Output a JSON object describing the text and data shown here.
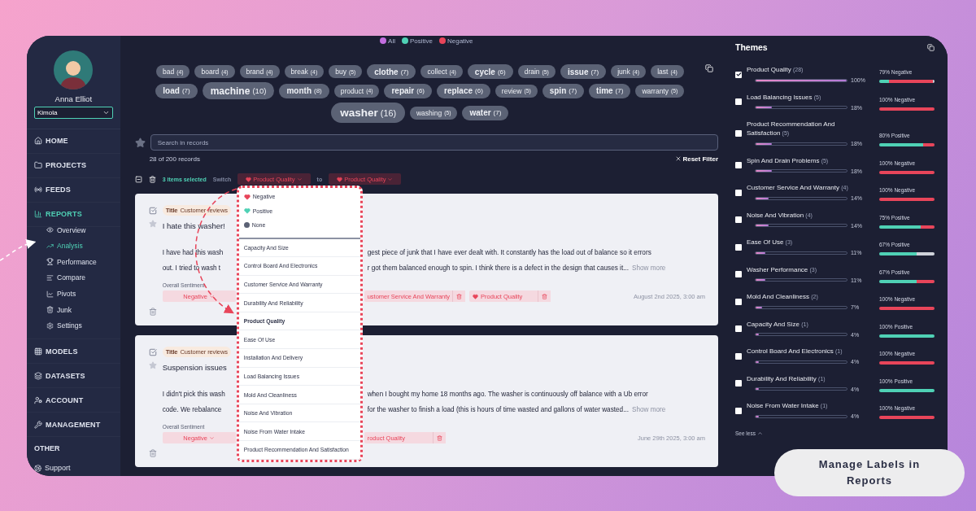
{
  "sidebar": {
    "user_name": "Anna Elliot",
    "workspace": "Kimola",
    "nav": [
      {
        "label": "HOME",
        "kind": "section",
        "selected": false
      },
      {
        "label": "PROJECTS",
        "kind": "section",
        "selected": false
      },
      {
        "label": "FEEDS",
        "kind": "section",
        "selected": false
      },
      {
        "label": "REPORTS",
        "kind": "section",
        "selected": true,
        "children": [
          {
            "label": "Overview",
            "selected": false
          },
          {
            "label": "Analysis",
            "selected": true
          },
          {
            "label": "Performance",
            "selected": false
          },
          {
            "label": "Compare",
            "selected": false
          },
          {
            "label": "Pivots",
            "selected": false
          },
          {
            "label": "Junk",
            "selected": false
          },
          {
            "label": "Settings",
            "selected": false
          }
        ]
      },
      {
        "label": "MODELS",
        "kind": "section",
        "selected": false
      },
      {
        "label": "DATASETS",
        "kind": "section",
        "selected": false
      },
      {
        "label": "ACCOUNT",
        "kind": "section",
        "selected": false
      },
      {
        "label": "MANAGEMENT",
        "kind": "section",
        "selected": false
      },
      {
        "label": "OTHER",
        "kind": "heading"
      },
      {
        "label": "Support",
        "kind": "link",
        "selected": false
      }
    ]
  },
  "legend": [
    {
      "label": "All",
      "color": "#c36ee0"
    },
    {
      "label": "Positive",
      "color": "#4fd1b5"
    },
    {
      "label": "Negative",
      "color": "#e8455a"
    }
  ],
  "tag_rows": [
    [
      {
        "word": "bad",
        "count": "(4)",
        "kind": "s"
      },
      {
        "word": "board",
        "count": "(4)",
        "kind": "s"
      },
      {
        "word": "brand",
        "count": "(4)",
        "kind": "s"
      },
      {
        "word": "break",
        "count": "(4)",
        "kind": "s"
      },
      {
        "word": "buy",
        "count": "(5)",
        "kind": "s"
      },
      {
        "word": "clothe",
        "count": "(7)",
        "kind": "m"
      },
      {
        "word": "collect",
        "count": "(4)",
        "kind": "s"
      },
      {
        "word": "cycle",
        "count": "(6)",
        "kind": "m"
      },
      {
        "word": "drain",
        "count": "(5)",
        "kind": "s"
      },
      {
        "word": "issue",
        "count": "(7)",
        "kind": "m"
      },
      {
        "word": "junk",
        "count": "(4)",
        "kind": "s"
      },
      {
        "word": "last",
        "count": "(4)",
        "kind": "s"
      }
    ],
    [
      {
        "word": "load",
        "count": "(7)",
        "kind": "m"
      },
      {
        "word": "machine",
        "count": "(10)",
        "kind": "l"
      },
      {
        "word": "month",
        "count": "(8)",
        "kind": "m"
      },
      {
        "word": "product",
        "count": "(4)",
        "kind": "s"
      },
      {
        "word": "repair",
        "count": "(6)",
        "kind": "m"
      },
      {
        "word": "replace",
        "count": "(6)",
        "kind": "m"
      },
      {
        "word": "review",
        "count": "(5)",
        "kind": "s"
      },
      {
        "word": "spin",
        "count": "(7)",
        "kind": "m"
      },
      {
        "word": "time",
        "count": "(7)",
        "kind": "m"
      },
      {
        "word": "warranty",
        "count": "(5)",
        "kind": "s"
      }
    ],
    [
      {
        "word": "washer",
        "count": "(16)",
        "kind": "xl"
      },
      {
        "word": "washing",
        "count": "(5)",
        "kind": "s"
      },
      {
        "word": "water",
        "count": "(7)",
        "kind": "m"
      }
    ]
  ],
  "search": {
    "placeholder": "Search in records"
  },
  "record_count": "28 of 200 records",
  "reset_filter": "Reset Filter",
  "bulk_bar": {
    "selected_text": "3 items selected",
    "switch_label": "Switch",
    "from": "Product Quality",
    "to_label": "to",
    "to": "Product Quality"
  },
  "dropdown": {
    "sentiments": [
      {
        "label": "Negative",
        "kind": "negative"
      },
      {
        "label": "Positive",
        "kind": "positive"
      },
      {
        "label": "None",
        "kind": "none"
      }
    ],
    "themes": [
      {
        "label": "Capacity And Size",
        "selected": false
      },
      {
        "label": "Control Board And Electronics",
        "selected": false
      },
      {
        "label": "Customer Service And Warranty",
        "selected": false
      },
      {
        "label": "Durability And Reliability",
        "selected": false
      },
      {
        "label": "Product Quality",
        "selected": true
      },
      {
        "label": "Ease Of Use",
        "selected": false
      },
      {
        "label": "Installation And Delivery",
        "selected": false
      },
      {
        "label": "Load Balancing Issues",
        "selected": false
      },
      {
        "label": "Mold And Cleanliness",
        "selected": false
      },
      {
        "label": "Noise And Vibration",
        "selected": false
      },
      {
        "label": "Noise From Water Intake",
        "selected": false
      },
      {
        "label": "Product Recommendation And Satisfaction",
        "selected": false
      }
    ]
  },
  "records": [
    {
      "checked": true,
      "title_label": "Title",
      "title_value": "Customer reviews",
      "heading": "I hate this washer!",
      "lines": [
        {
          "left": "I have had this wash",
          "right": "gest piece of junk that I have ever dealt with. It constantly has the load out of balance so it errors"
        },
        {
          "left": "out. I tried to wash t",
          "right": "r got them balanced enough to spin. I think there is a defect in the design that causes it..."
        }
      ],
      "show_more": "Show more",
      "sentiment_label": "Overall Sentiment",
      "sentiment": "Negative",
      "labels": [
        {
          "text": "ustomer Service And Warranty",
          "icon": false
        },
        {
          "text": "Product Quality",
          "icon": true
        }
      ],
      "date": "August 2nd 2025, 3:00 am"
    },
    {
      "checked": true,
      "title_label": "Title",
      "title_value": "Customer reviews",
      "heading": "Suspension issues",
      "lines": [
        {
          "left": "I didn't pick this wash",
          "right": "when I bought my home 18 months ago. The washer is continuously off balance with a Ub error"
        },
        {
          "left": "code. We rebalance",
          "right": "for the washer to finish a load (this is hours of time wasted and gallons of water wasted..."
        }
      ],
      "show_more": "Show more",
      "sentiment_label": "Overall Sentiment",
      "sentiment": "Negative",
      "labels": [
        {
          "text": "roduct Quality",
          "icon": false
        }
      ],
      "date": "June 29th 2025, 3:00 am"
    }
  ],
  "themes": {
    "title": "Themes",
    "see_less": "See less",
    "items": [
      {
        "name": "Product Quality",
        "count": "(28)",
        "checked": true,
        "level": 1,
        "percent": "100%",
        "sentiment": "79% Negative",
        "split": [
          {
            "kind": "positive",
            "level": 0.18
          },
          {
            "kind": "negative",
            "level": 0.79
          },
          {
            "kind": "neutral",
            "level": 0.03
          }
        ]
      },
      {
        "name": "Load Balancing Issues",
        "count": "(5)",
        "checked": false,
        "level": 0.18,
        "percent": "18%",
        "sentiment": "100% Negative",
        "split": [
          {
            "kind": "negative",
            "level": 1
          }
        ]
      },
      {
        "name": "Product Recommendation And Satisfaction",
        "count": "(5)",
        "checked": false,
        "level": 0.18,
        "percent": "18%",
        "sentiment": "80% Positive",
        "split": [
          {
            "kind": "positive",
            "level": 0.8
          },
          {
            "kind": "negative",
            "level": 0.2
          }
        ]
      },
      {
        "name": "Spin And Drain Problems",
        "count": "(5)",
        "checked": false,
        "level": 0.18,
        "percent": "18%",
        "sentiment": "100% Negative",
        "split": [
          {
            "kind": "negative",
            "level": 1
          }
        ]
      },
      {
        "name": "Customer Service And Warranty",
        "count": "(4)",
        "checked": false,
        "level": 0.14,
        "percent": "14%",
        "sentiment": "100% Negative",
        "split": [
          {
            "kind": "negative",
            "level": 1
          }
        ]
      },
      {
        "name": "Noise And Vibration",
        "count": "(4)",
        "checked": false,
        "level": 0.14,
        "percent": "14%",
        "sentiment": "75% Positive",
        "split": [
          {
            "kind": "positive",
            "level": 0.75
          },
          {
            "kind": "negative",
            "level": 0.25
          }
        ]
      },
      {
        "name": "Ease Of Use",
        "count": "(3)",
        "checked": false,
        "level": 0.11,
        "percent": "11%",
        "sentiment": "67% Positive",
        "split": [
          {
            "kind": "positive",
            "level": 0.67
          },
          {
            "kind": "neutral",
            "level": 0.33
          }
        ]
      },
      {
        "name": "Washer Performance",
        "count": "(3)",
        "checked": false,
        "level": 0.11,
        "percent": "11%",
        "sentiment": "67% Positive",
        "split": [
          {
            "kind": "positive",
            "level": 0.67
          },
          {
            "kind": "negative",
            "level": 0.33
          }
        ]
      },
      {
        "name": "Mold And Cleanliness",
        "count": "(2)",
        "checked": false,
        "level": 0.07,
        "percent": "7%",
        "sentiment": "100% Negative",
        "split": [
          {
            "kind": "negative",
            "level": 1
          }
        ]
      },
      {
        "name": "Capacity And Size",
        "count": "(1)",
        "checked": false,
        "level": 0.04,
        "percent": "4%",
        "sentiment": "100% Positive",
        "split": [
          {
            "kind": "positive",
            "level": 1
          }
        ]
      },
      {
        "name": "Control Board And Electronics",
        "count": "(1)",
        "checked": false,
        "level": 0.04,
        "percent": "4%",
        "sentiment": "100% Negative",
        "split": [
          {
            "kind": "negative",
            "level": 1
          }
        ]
      },
      {
        "name": "Durability And Reliability",
        "count": "(1)",
        "checked": false,
        "level": 0.04,
        "percent": "4%",
        "sentiment": "100% Positive",
        "split": [
          {
            "kind": "positive",
            "level": 1
          }
        ]
      },
      {
        "name": "Noise From Water Intake",
        "count": "(1)",
        "checked": false,
        "level": 0.04,
        "percent": "4%",
        "sentiment": "100% Negative",
        "split": [
          {
            "kind": "negative",
            "level": 1
          }
        ]
      }
    ]
  },
  "caption": "Manage Labels in Reports"
}
